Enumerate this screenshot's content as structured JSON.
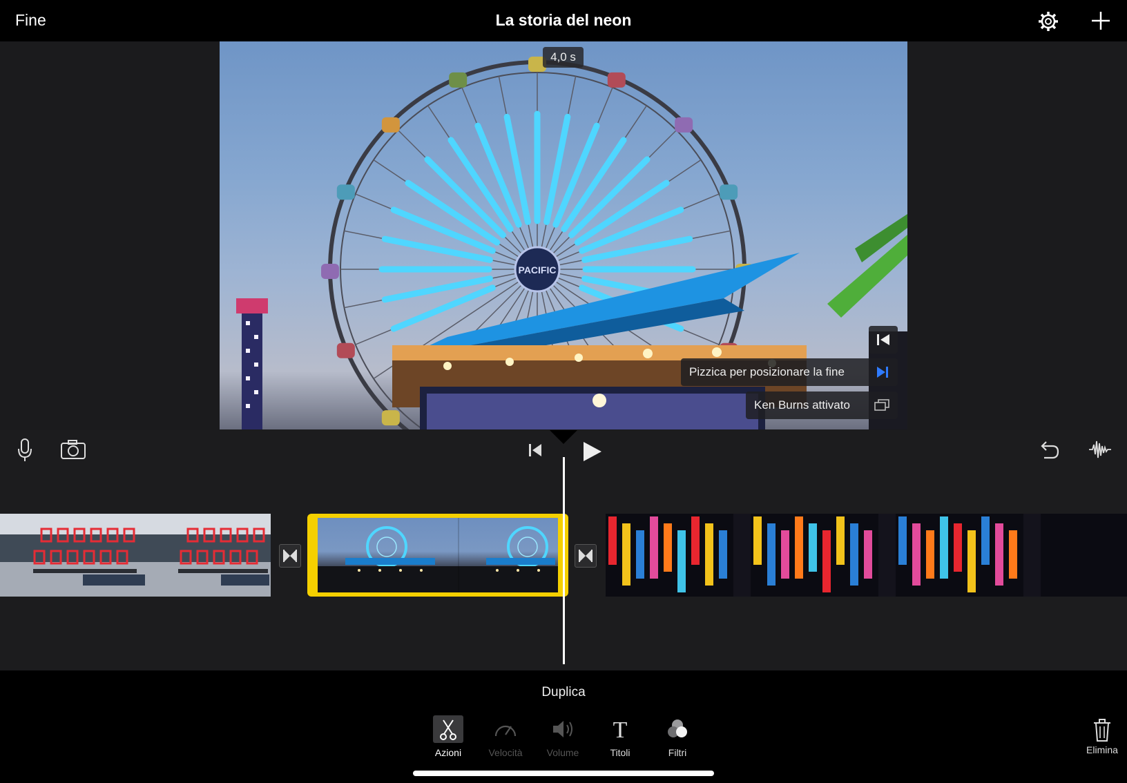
{
  "header": {
    "done_label": "Fine",
    "title": "La storia del neon"
  },
  "viewer": {
    "duration": "4,0 s",
    "pinch_hint": "Pizzica per posizionare la fine",
    "ken_burns": "Ken Burns attivato"
  },
  "clips": [
    {
      "name": "public-market",
      "selected": false
    },
    {
      "name": "ferris-wheel",
      "selected": true
    },
    {
      "name": "neon-street",
      "selected": false
    }
  ],
  "actions": {
    "hint": "Duplica"
  },
  "toolbar": {
    "actions": "Azioni",
    "speed": "Velocità",
    "volume": "Volume",
    "titles": "Titoli",
    "filters": "Filtri",
    "delete": "Elimina"
  },
  "colors": {
    "selection": "#f5d000",
    "neon": "#4fd6ff",
    "accent": "#2f7bff"
  }
}
